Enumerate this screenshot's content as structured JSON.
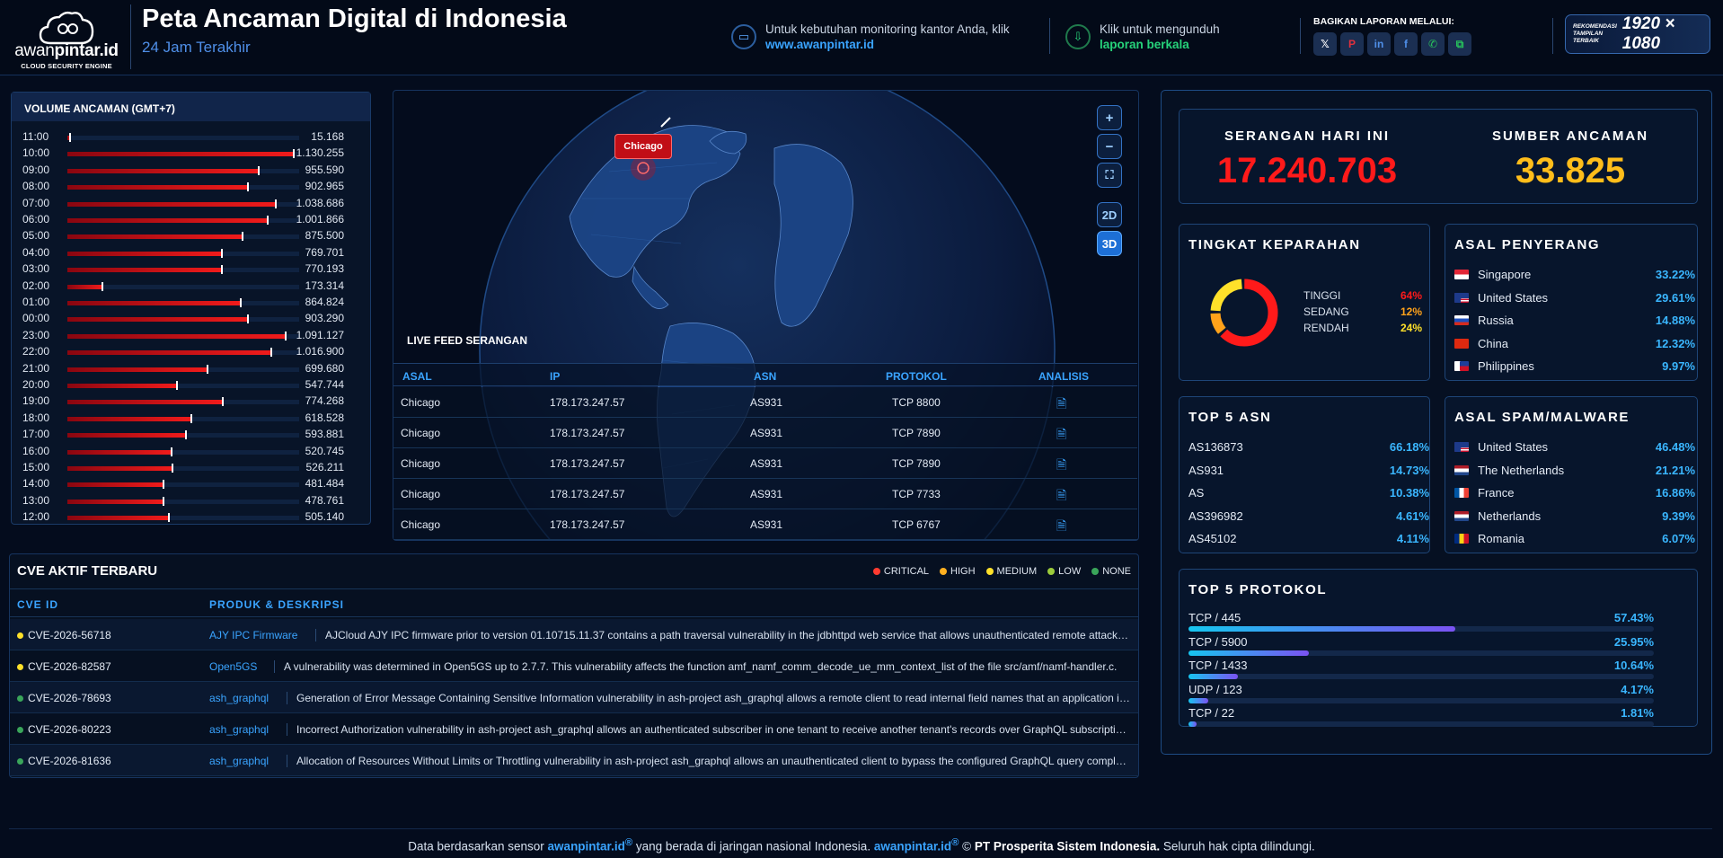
{
  "header": {
    "logo_name_a": "awan",
    "logo_name_b": "pintar.id",
    "logo_sub": "CLOUD SECURITY ENGINE",
    "title": "Peta Ancaman Digital di Indonesia",
    "subtitle": "24 Jam Terakhir",
    "monitor_text": "Untuk kebutuhan monitoring kantor Anda, klik",
    "monitor_link": "www.awanpintar.id",
    "download_text": "Klik untuk mengunduh",
    "download_link": "laporan berkala",
    "share_label": "BAGIKAN LAPORAN MELALUI:",
    "share_buttons": [
      {
        "icon": "x-icon",
        "glyph": "𝕏",
        "color": "#ffffff"
      },
      {
        "icon": "pinterest-icon",
        "glyph": "P",
        "color": "#e0303d"
      },
      {
        "icon": "linkedin-icon",
        "glyph": "in",
        "color": "#4f8fe8"
      },
      {
        "icon": "facebook-icon",
        "glyph": "f",
        "color": "#4f8fe8"
      },
      {
        "icon": "whatsapp-icon",
        "glyph": "✆",
        "color": "#27c25c"
      },
      {
        "icon": "copy-link-icon",
        "glyph": "⧉",
        "color": "#27c25c"
      }
    ],
    "rec_small": "REKOMENDASI TAMPILAN TERBAIK",
    "rec_big": "1920 × 1080"
  },
  "volume": {
    "title": "VOLUME ANCAMAN (GMT+7)",
    "max": 1130255,
    "rows": [
      {
        "time": "11:00",
        "label": "15.168",
        "value": 15168
      },
      {
        "time": "10:00",
        "label": "1.130.255",
        "value": 1130255
      },
      {
        "time": "09:00",
        "label": "955.590",
        "value": 955590
      },
      {
        "time": "08:00",
        "label": "902.965",
        "value": 902965
      },
      {
        "time": "07:00",
        "label": "1.038.686",
        "value": 1038686
      },
      {
        "time": "06:00",
        "label": "1.001.866",
        "value": 1001866
      },
      {
        "time": "05:00",
        "label": "875.500",
        "value": 875500
      },
      {
        "time": "04:00",
        "label": "769.701",
        "value": 769701
      },
      {
        "time": "03:00",
        "label": "770.193",
        "value": 770193
      },
      {
        "time": "02:00",
        "label": "173.314",
        "value": 173314
      },
      {
        "time": "01:00",
        "label": "864.824",
        "value": 864824
      },
      {
        "time": "00:00",
        "label": "903.290",
        "value": 903290
      },
      {
        "time": "23:00",
        "label": "1.091.127",
        "value": 1091127
      },
      {
        "time": "22:00",
        "label": "1.016.900",
        "value": 1016900
      },
      {
        "time": "21:00",
        "label": "699.680",
        "value": 699680
      },
      {
        "time": "20:00",
        "label": "547.744",
        "value": 547744
      },
      {
        "time": "19:00",
        "label": "774.268",
        "value": 774268
      },
      {
        "time": "18:00",
        "label": "618.528",
        "value": 618528
      },
      {
        "time": "17:00",
        "label": "593.881",
        "value": 593881
      },
      {
        "time": "16:00",
        "label": "520.745",
        "value": 520745
      },
      {
        "time": "15:00",
        "label": "526.211",
        "value": 526211
      },
      {
        "time": "14:00",
        "label": "481.484",
        "value": 481484
      },
      {
        "time": "13:00",
        "label": "478.761",
        "value": 478761
      },
      {
        "time": "12:00",
        "label": "505.140",
        "value": 505140
      }
    ]
  },
  "map": {
    "city": "Chicago",
    "zoom_in": "+",
    "zoom_out": "−",
    "fullscreen": "⛶",
    "mode_2d": "2D",
    "mode_3d": "3D",
    "active_mode": "3D"
  },
  "feed": {
    "title": "LIVE FEED SERANGAN",
    "columns": [
      "ASAL",
      "IP",
      "ASN",
      "PROTOKOL",
      "ANALISIS"
    ],
    "rows": [
      {
        "asal": "Chicago",
        "ip": "178.173.247.57",
        "asn": "AS931",
        "protokol": "TCP 8800"
      },
      {
        "asal": "Chicago",
        "ip": "178.173.247.57",
        "asn": "AS931",
        "protokol": "TCP 7890"
      },
      {
        "asal": "Chicago",
        "ip": "178.173.247.57",
        "asn": "AS931",
        "protokol": "TCP 7890"
      },
      {
        "asal": "Chicago",
        "ip": "178.173.247.57",
        "asn": "AS931",
        "protokol": "TCP 7733"
      },
      {
        "asal": "Chicago",
        "ip": "178.173.247.57",
        "asn": "AS931",
        "protokol": "TCP 6767"
      }
    ]
  },
  "cve": {
    "title": "CVE AKTIF TERBARU",
    "legend": [
      {
        "label": "CRITICAL",
        "color": "#ff3b30"
      },
      {
        "label": "HIGH",
        "color": "#ffb020"
      },
      {
        "label": "MEDIUM",
        "color": "#ffe12a"
      },
      {
        "label": "LOW",
        "color": "#9ccb3b"
      },
      {
        "label": "NONE",
        "color": "#3aa55a"
      }
    ],
    "col_id": "CVE ID",
    "col_prod": "PRODUK & DESKRIPSI",
    "rows": [
      {
        "id": "CVE-2026-56718",
        "color": "#ffe12a",
        "product": "AJY IPC Firmware",
        "desc": "AJCloud AJY IPC firmware prior to version 01.10715.11.37 contains a path traversal vulnerability in the jdbhttpd web service that allows unauthenticated remote attackers to read arbitrary files."
      },
      {
        "id": "CVE-2026-82587",
        "color": "#ffe12a",
        "product": "Open5GS",
        "desc": "A vulnerability was determined in Open5GS up to 2.7.7. This vulnerability affects the function amf_namf_comm_decode_ue_mm_context_list of the file src/amf/namf-handler.c."
      },
      {
        "id": "CVE-2026-78693",
        "color": "#3aa55a",
        "product": "ash_graphql",
        "desc": "Generation of Error Message Containing Sensitive Information vulnerability in ash-project ash_graphql allows a remote client to read internal field names that an application intends to hide."
      },
      {
        "id": "CVE-2026-80223",
        "color": "#3aa55a",
        "product": "ash_graphql",
        "desc": "Incorrect Authorization vulnerability in ash-project ash_graphql allows an authenticated subscriber in one tenant to receive another tenant's records over GraphQL subscriptions."
      },
      {
        "id": "CVE-2026-81636",
        "color": "#3aa55a",
        "product": "ash_graphql",
        "desc": "Allocation of Resources Without Limits or Throttling vulnerability in ash-project ash_graphql allows an unauthenticated client to bypass the configured GraphQL query complexity limits."
      }
    ]
  },
  "stats": {
    "attacks_label": "SERANGAN HARI INI",
    "attacks_value": "17.240.703",
    "sources_label": "SUMBER ANCAMAN",
    "sources_value": "33.825"
  },
  "severity": {
    "title": "TINGKAT KEPARAHAN",
    "items": [
      {
        "label": "TINGGI",
        "pct": "64%",
        "value": 64,
        "color": "#ff1a1a"
      },
      {
        "label": "SEDANG",
        "pct": "12%",
        "value": 12,
        "color": "#ffa21a"
      },
      {
        "label": "RENDAH",
        "pct": "24%",
        "value": 24,
        "color": "#ffe12a"
      }
    ]
  },
  "attacker_origin": {
    "title": "ASAL PENYERANG",
    "items": [
      {
        "name": "Singapore",
        "pct": "33.22%",
        "flag": "sg"
      },
      {
        "name": "United States",
        "pct": "29.61%",
        "flag": "us"
      },
      {
        "name": "Russia",
        "pct": "14.88%",
        "flag": "ru"
      },
      {
        "name": "China",
        "pct": "12.32%",
        "flag": "cn"
      },
      {
        "name": "Philippines",
        "pct": "9.97%",
        "flag": "ph"
      }
    ]
  },
  "top_asn": {
    "title": "TOP 5 ASN",
    "items": [
      {
        "name": "AS136873",
        "pct": "66.18%"
      },
      {
        "name": "AS931",
        "pct": "14.73%"
      },
      {
        "name": "AS",
        "pct": "10.38%"
      },
      {
        "name": "AS396982",
        "pct": "4.61%"
      },
      {
        "name": "AS45102",
        "pct": "4.11%"
      }
    ]
  },
  "spam_origin": {
    "title": "ASAL SPAM/MALWARE",
    "items": [
      {
        "name": "United States",
        "pct": "46.48%",
        "flag": "us"
      },
      {
        "name": "The Netherlands",
        "pct": "21.21%",
        "flag": "nl"
      },
      {
        "name": "France",
        "pct": "16.86%",
        "flag": "fr"
      },
      {
        "name": "Netherlands",
        "pct": "9.39%",
        "flag": "nl"
      },
      {
        "name": "Romania",
        "pct": "6.07%",
        "flag": "ro"
      }
    ]
  },
  "top_protocol": {
    "title": "TOP 5 PROTOKOL",
    "items": [
      {
        "name": "TCP / 445",
        "pct": "57.43%",
        "value": 57.43
      },
      {
        "name": "TCP / 5900",
        "pct": "25.95%",
        "value": 25.95
      },
      {
        "name": "TCP / 1433",
        "pct": "10.64%",
        "value": 10.64
      },
      {
        "name": "UDP / 123",
        "pct": "4.17%",
        "value": 4.17
      },
      {
        "name": "TCP / 22",
        "pct": "1.81%",
        "value": 1.81
      }
    ]
  },
  "footer": {
    "t1": "Data berdasarkan sensor ",
    "brand": "awanpintar.id",
    "reg": "®",
    "t2": " yang berada di jaringan nasional Indonesia. ",
    "brand2": "awanpintar.id",
    "reg2": "®",
    "t3": " © ",
    "company": "PT Prosperita Sistem Indonesia.",
    "t4": " Seluruh hak cipta dilindungi."
  }
}
